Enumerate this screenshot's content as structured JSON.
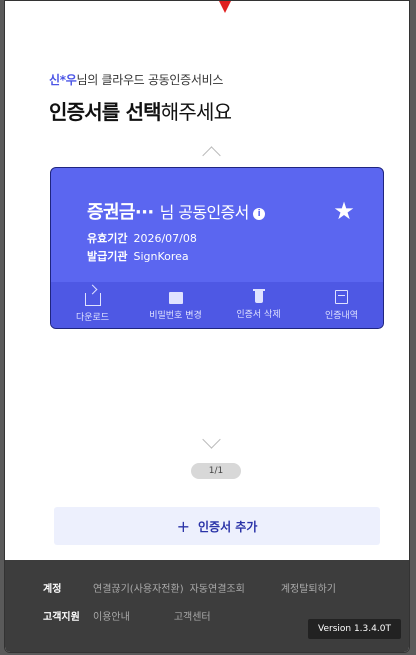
{
  "header": {
    "user_name": "신*우",
    "subtitle_suffix": "님의 클라우드 공동인증서비스",
    "title_bold": "인증서를 선택",
    "title_rest": "해주세요"
  },
  "card": {
    "name": "증권금···",
    "suffix": "님 공동인증서",
    "info_icon_label": "i",
    "validity_label": "유효기간",
    "validity_value": "2026/07/08",
    "issuer_label": "발급기관",
    "issuer_value": "SignKorea",
    "actions": [
      {
        "label": "다운로드",
        "icon": "download-icon"
      },
      {
        "label": "비밀번호 변경",
        "icon": "key-icon"
      },
      {
        "label": "인증서 삭제",
        "icon": "trash-icon"
      },
      {
        "label": "인증내역",
        "icon": "list-icon"
      }
    ]
  },
  "pager": {
    "text": "1/1"
  },
  "add_button": {
    "plus": "+",
    "label": "인증서 추가"
  },
  "footer": {
    "account_label": "계정",
    "account_links": [
      "연결끊기(사용자전환)",
      "자동연결조회",
      "계정탈퇴하기"
    ],
    "support_label": "고객지원",
    "support_links": [
      "이용안내",
      "고객센터"
    ],
    "version": "Version 1.3.4.0T"
  },
  "colors": {
    "accent": "#5b66f0",
    "accent_dark": "#4e58e4",
    "footer_bg": "#3d3d3d"
  }
}
